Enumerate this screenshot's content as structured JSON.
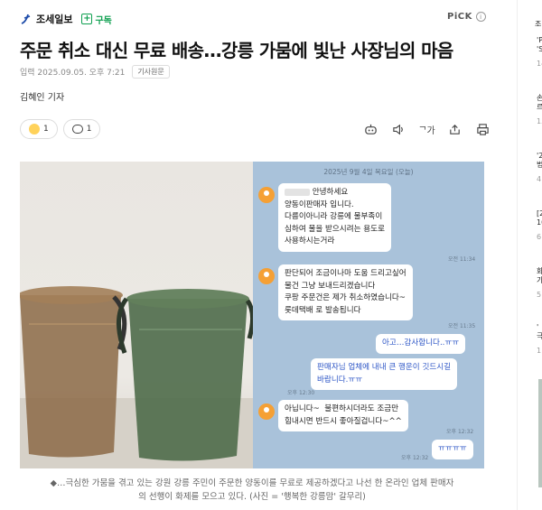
{
  "header": {
    "press_name": "조세일보",
    "subscribe_label": "구독",
    "pick_label": "PiCK",
    "pick_info": "i"
  },
  "article": {
    "title": "주문 취소 대신 무료 배송…강릉 가뭄에 빛난 사장님의 마음",
    "date": "입력 2025.09.05. 오후 7:21",
    "original_tag": "기사원문",
    "reporter": "김혜인 기자",
    "reactions": {
      "emoji_count": "1",
      "comment_count": "1"
    },
    "toolbar": {
      "font_size_label": "가"
    },
    "caption_line1": "◆…극심한 가뭄을 겪고 있는 강원 강릉 주민이 주문한 양동이를 무료로 제공하겠다고 나선 한 온라인 업체 판매자",
    "caption_line2": "의 선행이 화제를 모으고 있다. (사진 = '행복한 강릉맘' 갈무리)"
  },
  "chat": {
    "date_header": "2025년 9월 4일 목요일 (오늘)",
    "messages": [
      {
        "from": "seller",
        "text_prefix": "",
        "text": "안녕하세요\n양동이판매자 입니다.\n다름이아니라 강릉에 물부족이\n심하여 물을 받으시려는 용도로\n사용하시는거라",
        "time": "오전 11:34"
      },
      {
        "from": "seller",
        "text": "판단되어 조금이나마 도움 드리고싶어\n물건 그냥 보내드리겠습니다\n쿠팡 주문건은 제가 취소하였습니다~\n롯데택배 로 발송됩니다",
        "time": "오전 11:35"
      },
      {
        "from": "me",
        "text": "아고…감사합니다..ㅠㅠ",
        "time": ""
      },
      {
        "from": "me",
        "text": "판매자님 업체에 내내 큰 행운이 깃드시길\n바랍니다.ㅠㅠ",
        "time": "오후 12:30"
      },
      {
        "from": "seller",
        "text": "아닙니다~  불편하시더라도 조금만\n힘내시면 반드시 좋아질겁니다~^^",
        "time": "오후 12:32"
      },
      {
        "from": "me",
        "text": "ㅠㅠㅠㅠ",
        "time": "오후 12:32"
      }
    ]
  },
  "sidebar": {
    "items": [
      {
        "line1": "조",
        "line2": ""
      },
      {
        "line1": "'P",
        "line2": "'S"
      },
      {
        "line1": "14",
        "line2": ""
      },
      {
        "line1": "손",
        "line2": "르"
      },
      {
        "line1": "15",
        "line2": ""
      },
      {
        "line1": "'2",
        "line2": "법"
      },
      {
        "line1": "4",
        "line2": ""
      },
      {
        "line1": "[2",
        "line2": "10"
      },
      {
        "line1": "6",
        "line2": ""
      },
      {
        "line1": "화",
        "line2": "가"
      },
      {
        "line1": "5",
        "line2": ""
      },
      {
        "line1": "'",
        "line2": "극"
      },
      {
        "line1": "1",
        "line2": ""
      }
    ]
  },
  "colors": {
    "accent_green": "#0fa050",
    "chat_bg": "#a9c2da",
    "my_text_blue": "#2c55c6",
    "avatar_orange": "#f5a035"
  }
}
